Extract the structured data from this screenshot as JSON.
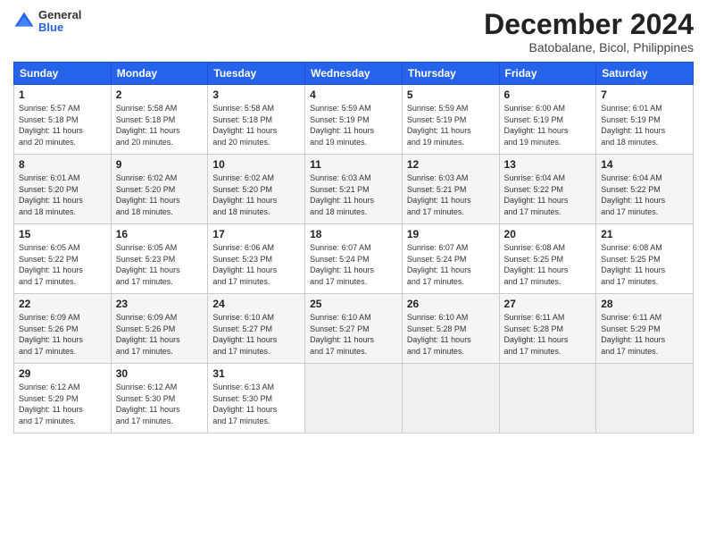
{
  "header": {
    "logo_general": "General",
    "logo_blue": "Blue",
    "month_title": "December 2024",
    "location": "Batobalane, Bicol, Philippines"
  },
  "weekdays": [
    "Sunday",
    "Monday",
    "Tuesday",
    "Wednesday",
    "Thursday",
    "Friday",
    "Saturday"
  ],
  "weeks": [
    [
      {
        "day": "1",
        "info": "Sunrise: 5:57 AM\nSunset: 5:18 PM\nDaylight: 11 hours\nand 20 minutes."
      },
      {
        "day": "2",
        "info": "Sunrise: 5:58 AM\nSunset: 5:18 PM\nDaylight: 11 hours\nand 20 minutes."
      },
      {
        "day": "3",
        "info": "Sunrise: 5:58 AM\nSunset: 5:18 PM\nDaylight: 11 hours\nand 20 minutes."
      },
      {
        "day": "4",
        "info": "Sunrise: 5:59 AM\nSunset: 5:19 PM\nDaylight: 11 hours\nand 19 minutes."
      },
      {
        "day": "5",
        "info": "Sunrise: 5:59 AM\nSunset: 5:19 PM\nDaylight: 11 hours\nand 19 minutes."
      },
      {
        "day": "6",
        "info": "Sunrise: 6:00 AM\nSunset: 5:19 PM\nDaylight: 11 hours\nand 19 minutes."
      },
      {
        "day": "7",
        "info": "Sunrise: 6:01 AM\nSunset: 5:19 PM\nDaylight: 11 hours\nand 18 minutes."
      }
    ],
    [
      {
        "day": "8",
        "info": "Sunrise: 6:01 AM\nSunset: 5:20 PM\nDaylight: 11 hours\nand 18 minutes."
      },
      {
        "day": "9",
        "info": "Sunrise: 6:02 AM\nSunset: 5:20 PM\nDaylight: 11 hours\nand 18 minutes."
      },
      {
        "day": "10",
        "info": "Sunrise: 6:02 AM\nSunset: 5:20 PM\nDaylight: 11 hours\nand 18 minutes."
      },
      {
        "day": "11",
        "info": "Sunrise: 6:03 AM\nSunset: 5:21 PM\nDaylight: 11 hours\nand 18 minutes."
      },
      {
        "day": "12",
        "info": "Sunrise: 6:03 AM\nSunset: 5:21 PM\nDaylight: 11 hours\nand 17 minutes."
      },
      {
        "day": "13",
        "info": "Sunrise: 6:04 AM\nSunset: 5:22 PM\nDaylight: 11 hours\nand 17 minutes."
      },
      {
        "day": "14",
        "info": "Sunrise: 6:04 AM\nSunset: 5:22 PM\nDaylight: 11 hours\nand 17 minutes."
      }
    ],
    [
      {
        "day": "15",
        "info": "Sunrise: 6:05 AM\nSunset: 5:22 PM\nDaylight: 11 hours\nand 17 minutes."
      },
      {
        "day": "16",
        "info": "Sunrise: 6:05 AM\nSunset: 5:23 PM\nDaylight: 11 hours\nand 17 minutes."
      },
      {
        "day": "17",
        "info": "Sunrise: 6:06 AM\nSunset: 5:23 PM\nDaylight: 11 hours\nand 17 minutes."
      },
      {
        "day": "18",
        "info": "Sunrise: 6:07 AM\nSunset: 5:24 PM\nDaylight: 11 hours\nand 17 minutes."
      },
      {
        "day": "19",
        "info": "Sunrise: 6:07 AM\nSunset: 5:24 PM\nDaylight: 11 hours\nand 17 minutes."
      },
      {
        "day": "20",
        "info": "Sunrise: 6:08 AM\nSunset: 5:25 PM\nDaylight: 11 hours\nand 17 minutes."
      },
      {
        "day": "21",
        "info": "Sunrise: 6:08 AM\nSunset: 5:25 PM\nDaylight: 11 hours\nand 17 minutes."
      }
    ],
    [
      {
        "day": "22",
        "info": "Sunrise: 6:09 AM\nSunset: 5:26 PM\nDaylight: 11 hours\nand 17 minutes."
      },
      {
        "day": "23",
        "info": "Sunrise: 6:09 AM\nSunset: 5:26 PM\nDaylight: 11 hours\nand 17 minutes."
      },
      {
        "day": "24",
        "info": "Sunrise: 6:10 AM\nSunset: 5:27 PM\nDaylight: 11 hours\nand 17 minutes."
      },
      {
        "day": "25",
        "info": "Sunrise: 6:10 AM\nSunset: 5:27 PM\nDaylight: 11 hours\nand 17 minutes."
      },
      {
        "day": "26",
        "info": "Sunrise: 6:10 AM\nSunset: 5:28 PM\nDaylight: 11 hours\nand 17 minutes."
      },
      {
        "day": "27",
        "info": "Sunrise: 6:11 AM\nSunset: 5:28 PM\nDaylight: 11 hours\nand 17 minutes."
      },
      {
        "day": "28",
        "info": "Sunrise: 6:11 AM\nSunset: 5:29 PM\nDaylight: 11 hours\nand 17 minutes."
      }
    ],
    [
      {
        "day": "29",
        "info": "Sunrise: 6:12 AM\nSunset: 5:29 PM\nDaylight: 11 hours\nand 17 minutes."
      },
      {
        "day": "30",
        "info": "Sunrise: 6:12 AM\nSunset: 5:30 PM\nDaylight: 11 hours\nand 17 minutes."
      },
      {
        "day": "31",
        "info": "Sunrise: 6:13 AM\nSunset: 5:30 PM\nDaylight: 11 hours\nand 17 minutes."
      },
      {
        "day": "",
        "info": ""
      },
      {
        "day": "",
        "info": ""
      },
      {
        "day": "",
        "info": ""
      },
      {
        "day": "",
        "info": ""
      }
    ]
  ]
}
